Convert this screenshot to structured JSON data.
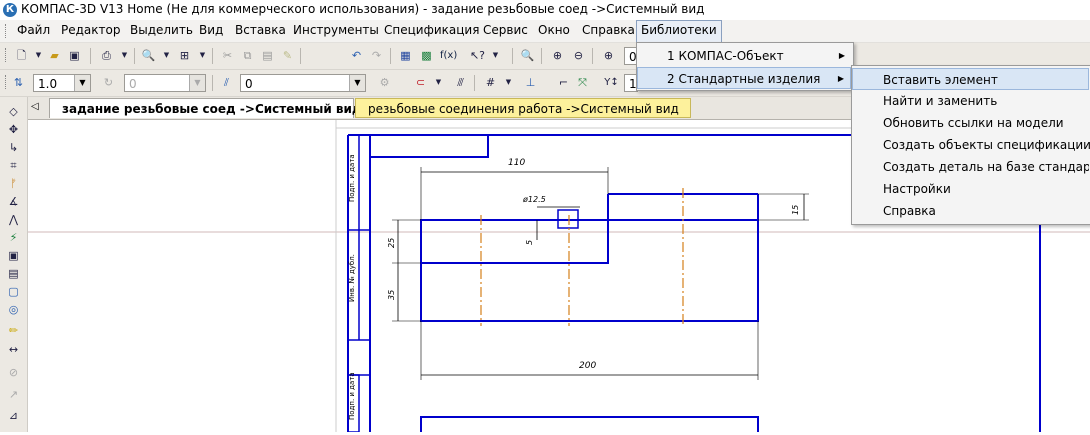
{
  "window": {
    "title": "КОМПАС-3D V13 Home (Не для коммерческого использования) - задание резьбовые соед ->Системный вид",
    "app_icon_letter": "К"
  },
  "menu": [
    {
      "label": "Файл"
    },
    {
      "label": "Редактор"
    },
    {
      "label": "Выделить"
    },
    {
      "label": "Вид"
    },
    {
      "label": "Вставка"
    },
    {
      "label": "Инструменты"
    },
    {
      "label": "Спецификация"
    },
    {
      "label": "Сервис"
    },
    {
      "label": "Окно"
    },
    {
      "label": "Справка"
    },
    {
      "label": "Библиотеки"
    }
  ],
  "toolbar2": {
    "style_value": "1.0",
    "angle_value": "0",
    "layer_value": "0",
    "zoom_value": "0"
  },
  "tabs": [
    {
      "label": "задание резьбовые соед ->Системный вид",
      "active": true
    },
    {
      "label": "резьбовые соединения работа ->Системный вид",
      "active": false
    }
  ],
  "libraries_menu": {
    "items": [
      {
        "label": "1 КОМПАС-Объект",
        "has_submenu": true
      },
      {
        "label": "2 Стандартные изделия",
        "has_submenu": true
      }
    ]
  },
  "standard_parts_menu": {
    "items": [
      {
        "label": "Вставить элемент"
      },
      {
        "label": "Найти и заменить"
      },
      {
        "label": "Обновить ссылки на модели"
      },
      {
        "label": "Создать объекты спецификации"
      },
      {
        "label": "Создать деталь на базе стандартной"
      },
      {
        "label": "Настройки"
      },
      {
        "label": "Справка"
      }
    ]
  },
  "drawing": {
    "dim_top": "110",
    "dim_bottom": "200",
    "dim_diameter": "ø12.5",
    "dim_left_upper": "25",
    "dim_left_lower": "35",
    "dim_small": "5",
    "dim_right": "15",
    "stamp_label_1": "Подп. и дата",
    "stamp_label_2": "Инв. № дубл.",
    "stamp_label_3": "Подп. и дата"
  },
  "colors": {
    "drawing_blue": "#0000cc",
    "axis_orange": "#d4801a",
    "tab_inactive_yellow": "#fdf19c",
    "menu_highlight": "#d9e6f5"
  }
}
